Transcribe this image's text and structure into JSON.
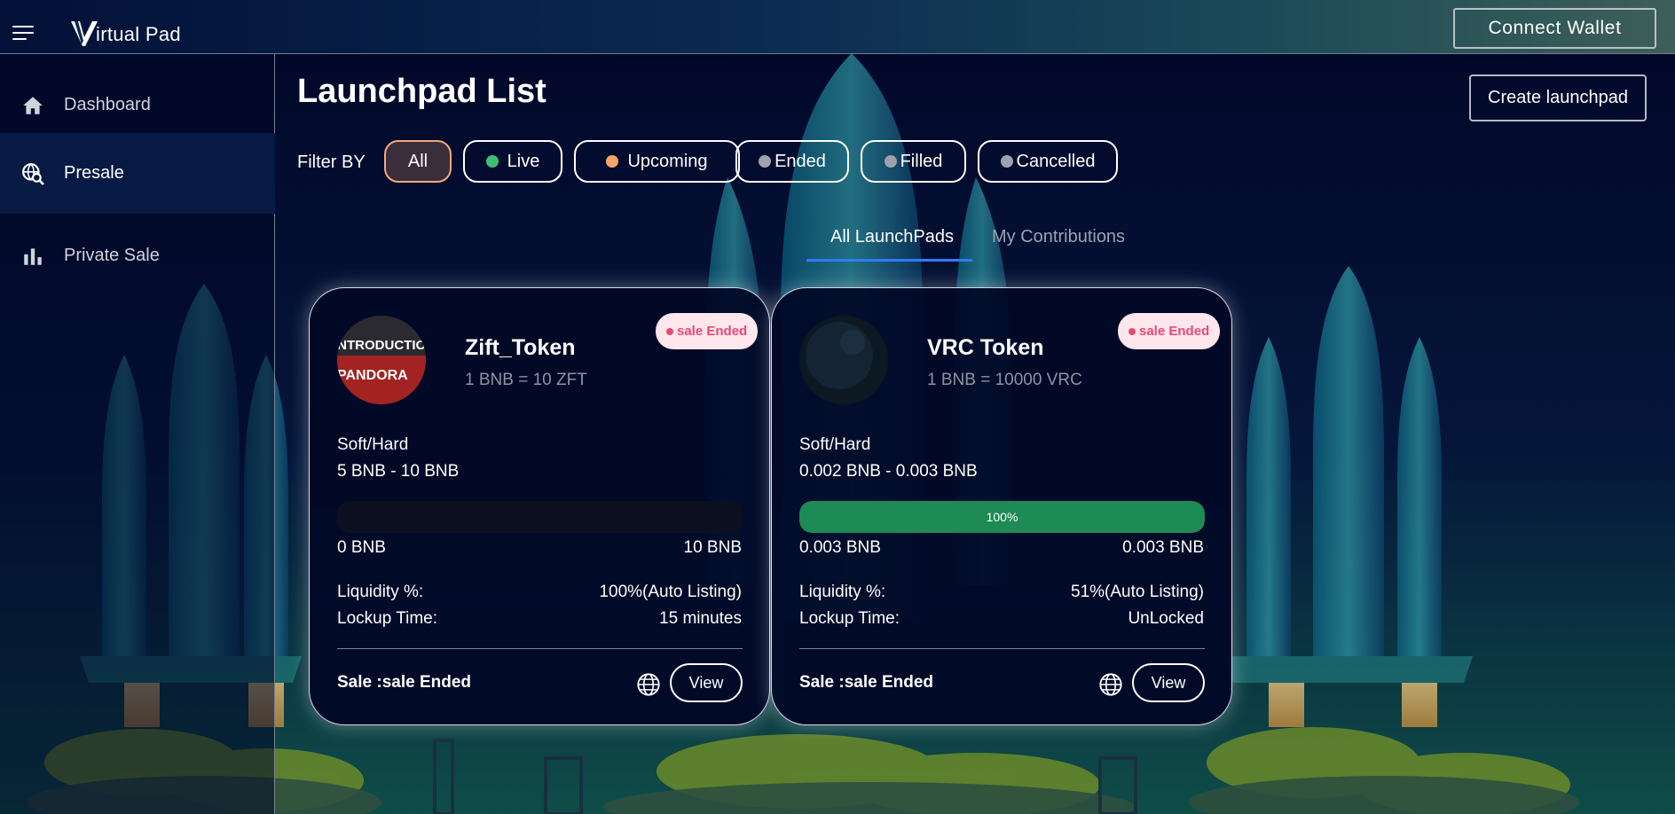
{
  "app": {
    "logo_text": "irtual Pad",
    "connect_wallet_label": "Connect Wallet"
  },
  "sidebar": {
    "items": [
      {
        "label": "Dashboard",
        "icon": "home-icon",
        "active": false
      },
      {
        "label": "Presale",
        "icon": "globe-search-icon",
        "active": true
      },
      {
        "label": "Private Sale",
        "icon": "bar-chart-icon",
        "active": false
      }
    ]
  },
  "main": {
    "title": "Launchpad List",
    "create_label": "Create launchpad",
    "filter_label": "Filter BY",
    "filters": [
      {
        "label": "All",
        "dot_color": null,
        "active": true
      },
      {
        "label": "Live",
        "dot_color": "#3fbf73",
        "active": false
      },
      {
        "label": "Upcoming",
        "dot_color": "#f5a46a",
        "active": false
      },
      {
        "label": "Ended",
        "dot_color": "#9ea2ad",
        "active": false
      },
      {
        "label": "Filled",
        "dot_color": "#9ea2ad",
        "active": false
      },
      {
        "label": "Cancelled",
        "dot_color": "#9ea2ad",
        "active": false
      }
    ],
    "tabs": [
      {
        "label": "All LaunchPads",
        "active": true
      },
      {
        "label": "My Contributions",
        "active": false
      }
    ]
  },
  "cards": [
    {
      "name": "Zift_Token",
      "rate": "1 BNB = 10 ZFT",
      "badge": "sale Ended",
      "caps_label": "Soft/Hard",
      "caps_value": "5 BNB - 10 BNB",
      "progress_percent": 0,
      "progress_label": "",
      "raised": "0 BNB",
      "hard_cap": "10 BNB",
      "liquidity_label": "Liquidity %:",
      "liquidity_value": "100%(Auto Listing)",
      "lockup_label": "Lockup Time:",
      "lockup_value": "15 minutes",
      "sale_status": "Sale :sale Ended",
      "view_label": "View",
      "avatar_text_1": "INTRODUCTION TO",
      "avatar_text_2": "PANDORA"
    },
    {
      "name": "VRC Token",
      "rate": "1 BNB = 10000 VRC",
      "badge": "sale Ended",
      "caps_label": "Soft/Hard",
      "caps_value": "0.002 BNB - 0.003 BNB",
      "progress_percent": 100,
      "progress_label": "100%",
      "raised": "0.003 BNB",
      "hard_cap": "0.003 BNB",
      "liquidity_label": "Liquidity %:",
      "liquidity_value": "51%(Auto Listing)",
      "lockup_label": "Lockup Time:",
      "lockup_value": "UnLocked",
      "sale_status": "Sale :sale Ended",
      "view_label": "View"
    }
  ]
}
